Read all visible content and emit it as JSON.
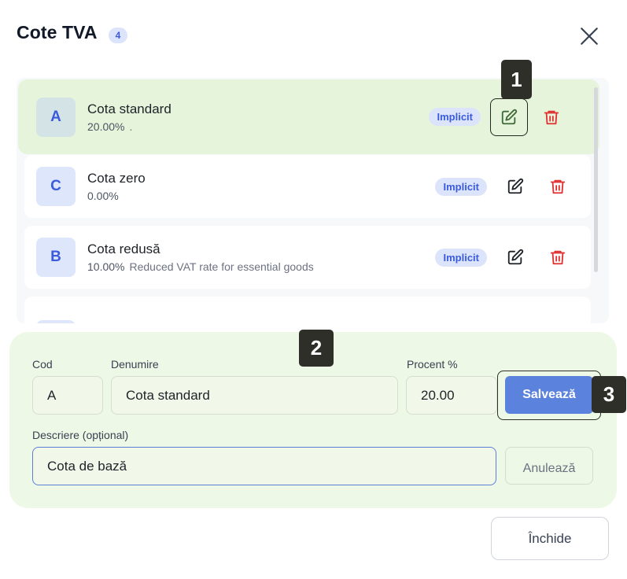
{
  "header": {
    "title": "Cote TVA",
    "count": "4"
  },
  "list": {
    "items": [
      {
        "code": "A",
        "name": "Cota standard",
        "percent": "20.00%",
        "description": ".",
        "badge": "Implicit"
      },
      {
        "code": "C",
        "name": "Cota zero",
        "percent": "0.00%",
        "description": "",
        "badge": "Implicit"
      },
      {
        "code": "B",
        "name": "Cota redusă",
        "percent": "10.00%",
        "description": "Reduced VAT rate for essential goods",
        "badge": "Implicit"
      },
      {
        "code": "",
        "name": "",
        "percent": "",
        "description": "",
        "badge": ""
      }
    ]
  },
  "markers": {
    "m1": "1",
    "m2": "2",
    "m3": "3"
  },
  "form": {
    "code_label": "Cod",
    "code_value": "A",
    "name_label": "Denumire",
    "name_value": "Cota standard",
    "percent_label": "Procent %",
    "percent_value": "20.00",
    "description_label": "Descriere (opțional)",
    "description_value": "Cota de bază",
    "save_label": "Salvează",
    "cancel_label": "Anulează"
  },
  "footer": {
    "close_label": "Închide"
  },
  "colors": {
    "accent": "#5b82dc",
    "selected_bg": "#e6f4dc",
    "delete": "#e03131",
    "badge_text": "#3b5bdb"
  }
}
